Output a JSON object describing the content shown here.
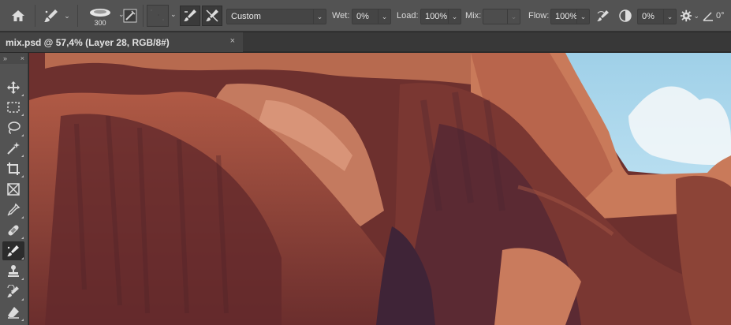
{
  "options_bar": {
    "brush_size": "300",
    "preset": "Custom",
    "wet_label": "Wet:",
    "wet_value": "0%",
    "load_label": "Load:",
    "load_value": "100%",
    "mix_label": "Mix:",
    "mix_value": "",
    "flow_label": "Flow:",
    "flow_value": "100%",
    "smoothing_value": "0%",
    "angle_value": "0°"
  },
  "document_tab": {
    "title": "mix.psd @ 57,4% (Layer 28, RGB/8#)",
    "close": "×"
  },
  "toolbar": {
    "collapse": "»",
    "close": "×",
    "tools": [
      {
        "name": "move-tool",
        "icon": "move-icon"
      },
      {
        "name": "marquee-tool",
        "icon": "marquee-icon"
      },
      {
        "name": "lasso-tool",
        "icon": "lasso-icon"
      },
      {
        "name": "magic-wand-tool",
        "icon": "magic-wand-icon"
      },
      {
        "name": "crop-tool",
        "icon": "crop-icon"
      },
      {
        "name": "frame-tool",
        "icon": "frame-icon"
      },
      {
        "name": "eyedropper-tool",
        "icon": "eyedropper-icon"
      },
      {
        "name": "healing-brush-tool",
        "icon": "bandage-icon"
      },
      {
        "name": "mixer-brush-tool",
        "icon": "mixer-brush-icon",
        "active": true
      },
      {
        "name": "clone-stamp-tool",
        "icon": "stamp-icon"
      },
      {
        "name": "history-brush-tool",
        "icon": "history-brush-icon"
      },
      {
        "name": "eraser-tool",
        "icon": "eraser-icon"
      }
    ]
  },
  "colors": {
    "ui_panel": "#535353",
    "ui_dark": "#383838",
    "sky": "#a9d6ea",
    "rock_light": "#c8775a",
    "rock_dark": "#6a2f2c",
    "rock_shadow": "#4a2636"
  }
}
